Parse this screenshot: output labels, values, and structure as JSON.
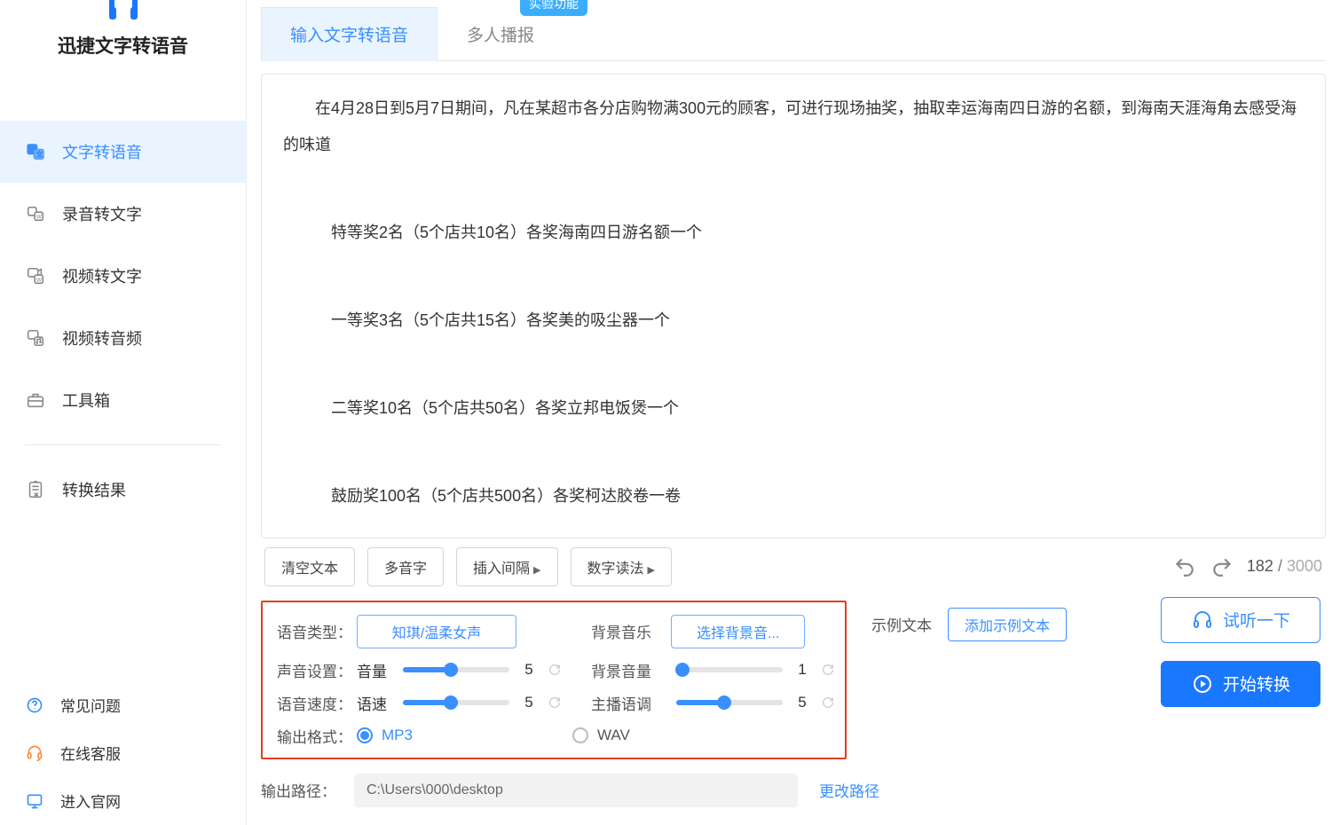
{
  "app": {
    "title": "迅捷文字转语音"
  },
  "sidebar": {
    "items": [
      {
        "label": "文字转语音"
      },
      {
        "label": "录音转文字"
      },
      {
        "label": "视频转文字"
      },
      {
        "label": "视频转音频"
      },
      {
        "label": "工具箱"
      }
    ],
    "results_label": "转换结果",
    "help": {
      "faq": "常见问题",
      "service": "在线客服",
      "website": "进入官网"
    }
  },
  "tabs": [
    {
      "label": "输入文字转语音",
      "active": true
    },
    {
      "label": "多人播报",
      "active": false,
      "badge": "实验功能"
    }
  ],
  "content": {
    "p1": "在4月28日到5月7日期间，凡在某超市各分店购物满300元的顾客，可进行现场抽奖，抽取幸运海南四日游的名额，到海南天涯海角去感受海的味道",
    "p2": "特等奖2名（5个店共10名）各奖海南四日游名额一个",
    "p3": "一等奖3名（5个店共15名）各奖美的吸尘器一个",
    "p4": "二等奖10名（5个店共50名）各奖立邦电饭煲一个",
    "p5": "鼓励奖100名（5个店共500名）各奖柯达胶卷一卷"
  },
  "action_bar": {
    "clear": "清空文本",
    "polyphonic": "多音字",
    "insert_pause": "插入间隔",
    "number_read": "数字读法",
    "count_current": "182",
    "count_max": "3000"
  },
  "settings": {
    "voice_type_label": "语音类型",
    "voice_type_value": "知琪/温柔女声",
    "bgm_label": "背景音乐",
    "bgm_value": "选择背景音...",
    "sound_label": "声音设置",
    "volume_label": "音量",
    "volume_value": "5",
    "volume_pct": 45,
    "bg_volume_label": "背景音量",
    "bg_volume_value": "1",
    "bg_volume_pct": 6,
    "speed_label": "语音速度",
    "speed_inner_label": "语速",
    "speed_value": "5",
    "speed_pct": 45,
    "pitch_label": "主播语调",
    "pitch_value": "5",
    "pitch_pct": 45,
    "output_fmt_label": "输出格式",
    "fmt_mp3": "MP3",
    "fmt_wav": "WAV",
    "sample_label": "示例文本",
    "sample_btn": "添加示例文本"
  },
  "output": {
    "path_label": "输出路径",
    "path_value": "C:\\Users\\000\\desktop",
    "change": "更改路径"
  },
  "buttons": {
    "listen": "试听一下",
    "convert": "开始转换"
  }
}
